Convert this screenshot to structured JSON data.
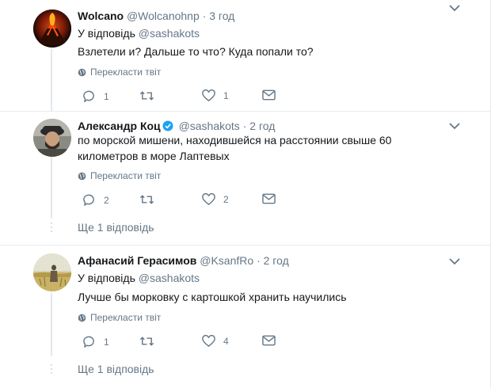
{
  "tweets": [
    {
      "name": "Wolcano",
      "handle": "@Wolcanohnp",
      "dot": "·",
      "time": "3 год",
      "reply_prefix": "У відповідь",
      "reply_handle": "@sashakots",
      "text": "Взлетели и? Дальше то что? Куда попали то?",
      "translate": "Перекласти твіт",
      "replies": "1",
      "retweets": "",
      "likes": "1",
      "avatar_icon": "volcano-avatar"
    },
    {
      "name": "Александр Коц",
      "handle": "@sashakots",
      "dot": "·",
      "time": "2 год",
      "verified": true,
      "text": "по морской мишени, находившейся на расстоянии свыше 60 километров в море Лаптевых",
      "translate": "Перекласти твіт",
      "replies": "2",
      "retweets": "",
      "likes": "2",
      "more_replies": "Ще 1 відповідь",
      "avatar_icon": "person-with-cap-avatar"
    },
    {
      "name": "Афанасий Герасимов",
      "handle": "@KsanfRo",
      "dot": "·",
      "time": "2 год",
      "reply_prefix": "У відповідь",
      "reply_handle": "@sashakots",
      "text": "Лучше бы морковку с картошкой хранить научились",
      "translate": "Перекласти твіт",
      "replies": "1",
      "retweets": "",
      "likes": "4",
      "more_replies": "Ще 1 відповідь",
      "avatar_icon": "field-painting-avatar"
    }
  ],
  "colors": {
    "text": "#14171a",
    "secondary": "#657786",
    "verified": "#1da1f2",
    "border": "#e6ecf0"
  }
}
